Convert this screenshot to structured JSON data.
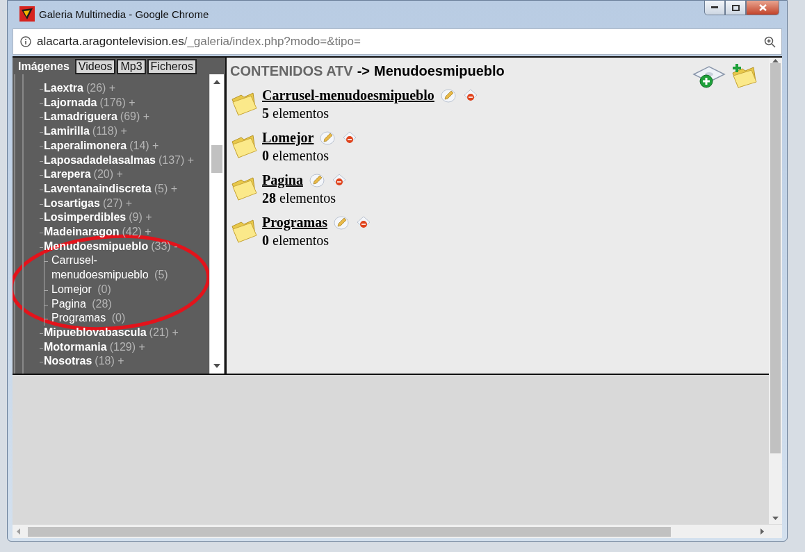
{
  "window": {
    "title": "Galeria Multimedia - Google Chrome"
  },
  "address_bar": {
    "domain": "alacarta.aragontelevision.es",
    "path": "/_galeria/index.php?modo=&tipo="
  },
  "tabs": [
    {
      "label": "Imágenes",
      "selected": true
    },
    {
      "label": "Videos",
      "selected": false
    },
    {
      "label": "Mp3",
      "selected": false
    },
    {
      "label": "Ficheros",
      "selected": false
    }
  ],
  "tree": [
    {
      "name": "Laextra",
      "count": "(26)",
      "toggle": "+"
    },
    {
      "name": "Lajornada",
      "count": "(176)",
      "toggle": "+"
    },
    {
      "name": "Lamadriguera",
      "count": "(69)",
      "toggle": "+"
    },
    {
      "name": "Lamirilla",
      "count": "(118)",
      "toggle": "+"
    },
    {
      "name": "Laperalimonera",
      "count": "(14)",
      "toggle": "+"
    },
    {
      "name": "Laposadadelasalmas",
      "count": "(137)",
      "toggle": "+"
    },
    {
      "name": "Larepera",
      "count": "(20)",
      "toggle": "+"
    },
    {
      "name": "Laventanaindiscreta",
      "count": "(5)",
      "toggle": "+"
    },
    {
      "name": "Losartigas",
      "count": "(27)",
      "toggle": "+"
    },
    {
      "name": "Losimperdibles",
      "count": "(9)",
      "toggle": "+"
    },
    {
      "name": "Madeinaragon",
      "count": "(42)",
      "toggle": "+"
    },
    {
      "name": "Menudoesmipueblo",
      "count": "(33)",
      "toggle": "-",
      "children": [
        {
          "name": "Carrusel-menudoesmipueblo",
          "count": "(5)"
        },
        {
          "name": "Lomejor",
          "count": "(0)"
        },
        {
          "name": "Pagina",
          "count": "(28)"
        },
        {
          "name": "Programas",
          "count": "(0)"
        }
      ]
    },
    {
      "name": "Mipueblovabascula",
      "count": "(21)",
      "toggle": "+"
    },
    {
      "name": "Motormania",
      "count": "(129)",
      "toggle": "+"
    },
    {
      "name": "Nosotras",
      "count": "(18)",
      "toggle": "+"
    }
  ],
  "annotation": {
    "kind": "ellipse"
  },
  "breadcrumb": {
    "root": "CONTENIDOS ATV",
    "separator": "->",
    "current": "Menudoesmipueblo"
  },
  "folders": [
    {
      "name": "Carrusel-menudoesmipueblo",
      "count": "5",
      "unit": "elementos"
    },
    {
      "name": "Lomejor",
      "count": "0",
      "unit": "elementos"
    },
    {
      "name": "Pagina",
      "count": "28",
      "unit": "elementos"
    },
    {
      "name": "Programas",
      "count": "0",
      "unit": "elementos"
    }
  ]
}
